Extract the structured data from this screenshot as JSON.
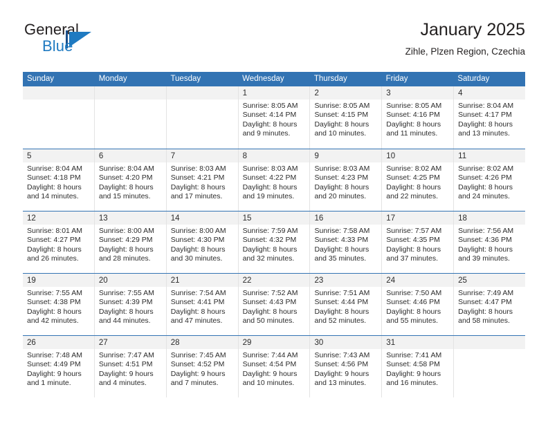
{
  "brand": {
    "name_part1": "General",
    "name_part2": "Blue",
    "accent_color": "#1f7ac1",
    "logo_icon": "triangle-flag-icon"
  },
  "header": {
    "title": "January 2025",
    "location": "Zihle, Plzen Region, Czechia",
    "header_bg_color": "#3273b3",
    "daynum_band_color": "#f2f2f2"
  },
  "weekdays": [
    "Sunday",
    "Monday",
    "Tuesday",
    "Wednesday",
    "Thursday",
    "Friday",
    "Saturday"
  ],
  "weeks": [
    [
      {
        "day": "",
        "lines": []
      },
      {
        "day": "",
        "lines": []
      },
      {
        "day": "",
        "lines": []
      },
      {
        "day": "1",
        "lines": [
          "Sunrise: 8:05 AM",
          "Sunset: 4:14 PM",
          "Daylight: 8 hours",
          "and 9 minutes."
        ]
      },
      {
        "day": "2",
        "lines": [
          "Sunrise: 8:05 AM",
          "Sunset: 4:15 PM",
          "Daylight: 8 hours",
          "and 10 minutes."
        ]
      },
      {
        "day": "3",
        "lines": [
          "Sunrise: 8:05 AM",
          "Sunset: 4:16 PM",
          "Daylight: 8 hours",
          "and 11 minutes."
        ]
      },
      {
        "day": "4",
        "lines": [
          "Sunrise: 8:04 AM",
          "Sunset: 4:17 PM",
          "Daylight: 8 hours",
          "and 13 minutes."
        ]
      }
    ],
    [
      {
        "day": "5",
        "lines": [
          "Sunrise: 8:04 AM",
          "Sunset: 4:18 PM",
          "Daylight: 8 hours",
          "and 14 minutes."
        ]
      },
      {
        "day": "6",
        "lines": [
          "Sunrise: 8:04 AM",
          "Sunset: 4:20 PM",
          "Daylight: 8 hours",
          "and 15 minutes."
        ]
      },
      {
        "day": "7",
        "lines": [
          "Sunrise: 8:03 AM",
          "Sunset: 4:21 PM",
          "Daylight: 8 hours",
          "and 17 minutes."
        ]
      },
      {
        "day": "8",
        "lines": [
          "Sunrise: 8:03 AM",
          "Sunset: 4:22 PM",
          "Daylight: 8 hours",
          "and 19 minutes."
        ]
      },
      {
        "day": "9",
        "lines": [
          "Sunrise: 8:03 AM",
          "Sunset: 4:23 PM",
          "Daylight: 8 hours",
          "and 20 minutes."
        ]
      },
      {
        "day": "10",
        "lines": [
          "Sunrise: 8:02 AM",
          "Sunset: 4:25 PM",
          "Daylight: 8 hours",
          "and 22 minutes."
        ]
      },
      {
        "day": "11",
        "lines": [
          "Sunrise: 8:02 AM",
          "Sunset: 4:26 PM",
          "Daylight: 8 hours",
          "and 24 minutes."
        ]
      }
    ],
    [
      {
        "day": "12",
        "lines": [
          "Sunrise: 8:01 AM",
          "Sunset: 4:27 PM",
          "Daylight: 8 hours",
          "and 26 minutes."
        ]
      },
      {
        "day": "13",
        "lines": [
          "Sunrise: 8:00 AM",
          "Sunset: 4:29 PM",
          "Daylight: 8 hours",
          "and 28 minutes."
        ]
      },
      {
        "day": "14",
        "lines": [
          "Sunrise: 8:00 AM",
          "Sunset: 4:30 PM",
          "Daylight: 8 hours",
          "and 30 minutes."
        ]
      },
      {
        "day": "15",
        "lines": [
          "Sunrise: 7:59 AM",
          "Sunset: 4:32 PM",
          "Daylight: 8 hours",
          "and 32 minutes."
        ]
      },
      {
        "day": "16",
        "lines": [
          "Sunrise: 7:58 AM",
          "Sunset: 4:33 PM",
          "Daylight: 8 hours",
          "and 35 minutes."
        ]
      },
      {
        "day": "17",
        "lines": [
          "Sunrise: 7:57 AM",
          "Sunset: 4:35 PM",
          "Daylight: 8 hours",
          "and 37 minutes."
        ]
      },
      {
        "day": "18",
        "lines": [
          "Sunrise: 7:56 AM",
          "Sunset: 4:36 PM",
          "Daylight: 8 hours",
          "and 39 minutes."
        ]
      }
    ],
    [
      {
        "day": "19",
        "lines": [
          "Sunrise: 7:55 AM",
          "Sunset: 4:38 PM",
          "Daylight: 8 hours",
          "and 42 minutes."
        ]
      },
      {
        "day": "20",
        "lines": [
          "Sunrise: 7:55 AM",
          "Sunset: 4:39 PM",
          "Daylight: 8 hours",
          "and 44 minutes."
        ]
      },
      {
        "day": "21",
        "lines": [
          "Sunrise: 7:54 AM",
          "Sunset: 4:41 PM",
          "Daylight: 8 hours",
          "and 47 minutes."
        ]
      },
      {
        "day": "22",
        "lines": [
          "Sunrise: 7:52 AM",
          "Sunset: 4:43 PM",
          "Daylight: 8 hours",
          "and 50 minutes."
        ]
      },
      {
        "day": "23",
        "lines": [
          "Sunrise: 7:51 AM",
          "Sunset: 4:44 PM",
          "Daylight: 8 hours",
          "and 52 minutes."
        ]
      },
      {
        "day": "24",
        "lines": [
          "Sunrise: 7:50 AM",
          "Sunset: 4:46 PM",
          "Daylight: 8 hours",
          "and 55 minutes."
        ]
      },
      {
        "day": "25",
        "lines": [
          "Sunrise: 7:49 AM",
          "Sunset: 4:47 PM",
          "Daylight: 8 hours",
          "and 58 minutes."
        ]
      }
    ],
    [
      {
        "day": "26",
        "lines": [
          "Sunrise: 7:48 AM",
          "Sunset: 4:49 PM",
          "Daylight: 9 hours",
          "and 1 minute."
        ]
      },
      {
        "day": "27",
        "lines": [
          "Sunrise: 7:47 AM",
          "Sunset: 4:51 PM",
          "Daylight: 9 hours",
          "and 4 minutes."
        ]
      },
      {
        "day": "28",
        "lines": [
          "Sunrise: 7:45 AM",
          "Sunset: 4:52 PM",
          "Daylight: 9 hours",
          "and 7 minutes."
        ]
      },
      {
        "day": "29",
        "lines": [
          "Sunrise: 7:44 AM",
          "Sunset: 4:54 PM",
          "Daylight: 9 hours",
          "and 10 minutes."
        ]
      },
      {
        "day": "30",
        "lines": [
          "Sunrise: 7:43 AM",
          "Sunset: 4:56 PM",
          "Daylight: 9 hours",
          "and 13 minutes."
        ]
      },
      {
        "day": "31",
        "lines": [
          "Sunrise: 7:41 AM",
          "Sunset: 4:58 PM",
          "Daylight: 9 hours",
          "and 16 minutes."
        ]
      },
      {
        "day": "",
        "lines": []
      }
    ]
  ]
}
